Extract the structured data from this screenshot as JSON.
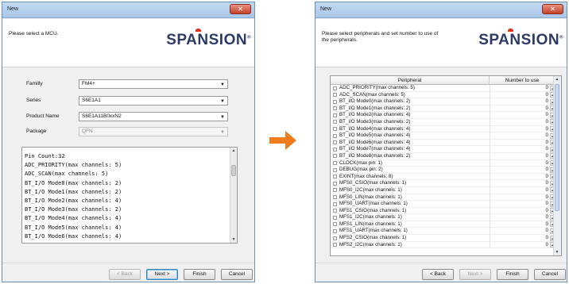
{
  "left_window": {
    "title": "New",
    "prompt": "Please select a MCU.",
    "logo": "SPANSION",
    "fields": [
      {
        "label": "Familly",
        "value": "FM4+",
        "disabled": false
      },
      {
        "label": "Series",
        "value": "S6E1A1",
        "disabled": false
      },
      {
        "label": "Product Name",
        "value": "S6E1A11B0xxN2",
        "disabled": false
      },
      {
        "label": "Package",
        "value": "QFN",
        "disabled": true
      }
    ],
    "info_lines": [
      "Pin Count:32",
      "ADC_PRIORITY(max channels: 5)",
      "ADC_SCAN(max channels: 5)",
      "BT_I/O Mode0(max channels: 2)",
      "BT_I/O Mode1(max channels: 2)",
      "BT_I/O Mode2(max channels: 4)",
      "BT_I/O Mode3(max channels: 2)",
      "BT_I/O Mode4(max channels: 4)",
      "BT_I/O Mode5(max channels: 4)",
      "BT_I/O Mode6(max channels: 4)"
    ],
    "buttons": {
      "back": "< Back",
      "next": "Next >",
      "finish": "Finish",
      "cancel": "Cancel"
    }
  },
  "right_window": {
    "title": "New",
    "prompt": "Please select peripherals and set number to use of the peripherals.",
    "logo": "SPANSION",
    "columns": [
      "Peripheral",
      "Number to use"
    ],
    "rows": [
      {
        "name": "ADC_PRIORITY(max channels: 5)",
        "value": "0"
      },
      {
        "name": "ADC_SCAN(max channels: 5)",
        "value": "0"
      },
      {
        "name": "BT_I/O Mode0(max channels: 2)",
        "value": "0"
      },
      {
        "name": "BT_I/O Mode1(max channels: 2)",
        "value": "0"
      },
      {
        "name": "BT_I/O Mode2(max channels: 4)",
        "value": "0"
      },
      {
        "name": "BT_I/O Mode3(max channels: 2)",
        "value": "0"
      },
      {
        "name": "BT_I/O Mode4(max channels: 4)",
        "value": "0"
      },
      {
        "name": "BT_I/O Mode5(max channels: 4)",
        "value": "0"
      },
      {
        "name": "BT_I/O Mode6(max channels: 4)",
        "value": "0"
      },
      {
        "name": "BT_I/O Mode7(max channels: 4)",
        "value": "0"
      },
      {
        "name": "BT_I/O Mode8(max channels: 2)",
        "value": "0"
      },
      {
        "name": "CLOCK(max pin: 1)",
        "value": "0"
      },
      {
        "name": "DEBUG(max pin: 2)",
        "value": "0"
      },
      {
        "name": "EXINT(max channels: 8)",
        "value": "0"
      },
      {
        "name": "MFS0_CSIO(max channels: 1)",
        "value": "0"
      },
      {
        "name": "MFS0_I2C(max channels: 1)",
        "value": "0"
      },
      {
        "name": "MFS0_LIN(max channels: 1)",
        "value": "0"
      },
      {
        "name": "MFS0_UART(max channels: 1)",
        "value": "0"
      },
      {
        "name": "MFS1_CSIO(max channels: 1)",
        "value": "0"
      },
      {
        "name": "MFS1_I2C(max channels: 1)",
        "value": "0"
      },
      {
        "name": "MFS1_LIN(max channels: 1)",
        "value": "0"
      },
      {
        "name": "MFS1_UART(max channels: 1)",
        "value": "0"
      },
      {
        "name": "MFS2_CSIO(max channels: 1)",
        "value": "0"
      },
      {
        "name": "MFS2_I2C(max channels: 1)",
        "value": "0"
      }
    ],
    "buttons": {
      "back": "< Back",
      "next": "Next >",
      "finish": "Finish",
      "cancel": "Cancel"
    }
  },
  "colors": {
    "arrow": "#f07c1e",
    "logo_text": "#2b3a67",
    "logo_dot": "#e2301a"
  },
  "icons": {
    "close": "close-icon",
    "arrow": "right-arrow-icon"
  }
}
